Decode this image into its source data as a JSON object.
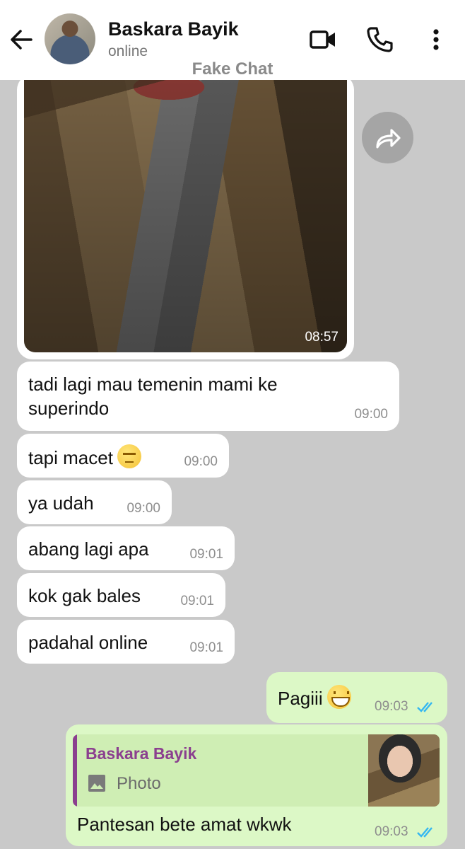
{
  "header": {
    "contact_name": "Baskara Bayik",
    "status": "online",
    "watermark": "Fake Chat",
    "icons": [
      "back-arrow-icon",
      "video-call-icon",
      "phone-icon",
      "more-vert-icon"
    ]
  },
  "photo_message": {
    "time": "08:57",
    "forward_icon": "forward-icon"
  },
  "incoming": [
    {
      "text": "tadi lagi mau temenin mami ke superindo",
      "time": "09:00"
    },
    {
      "text": "tapi macet",
      "emoji": "face-with-rolling-eyes",
      "time": "09:00"
    },
    {
      "text": "ya udah",
      "time": "09:00"
    },
    {
      "text": "abang lagi apa",
      "time": "09:01"
    },
    {
      "text": "kok gak bales",
      "time": "09:01"
    },
    {
      "text": "padahal online",
      "time": "09:01"
    }
  ],
  "outgoing": [
    {
      "text": "Pagiii",
      "emoji": "grinning-face",
      "time": "09:03",
      "status": "read",
      "tick_color": "#34b7f1"
    },
    {
      "reply": {
        "name": "Baskara Bayik",
        "type": "Photo",
        "icon": "image-icon",
        "accent": "#8b3f8f"
      },
      "text": "Pantesan bete amat wkwk",
      "time": "09:03",
      "status": "read",
      "tick_color": "#34b7f1"
    }
  ],
  "colors": {
    "chat_background": "#c9c9c9",
    "incoming_bubble": "#ffffff",
    "outgoing_bubble": "#dcf8c6"
  }
}
